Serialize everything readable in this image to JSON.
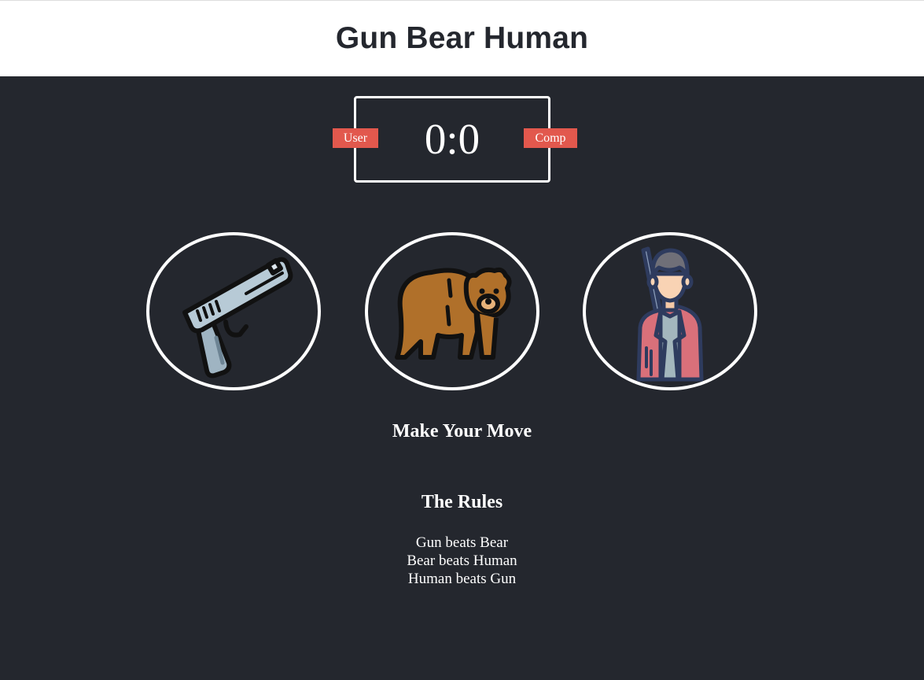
{
  "header": {
    "title": "Gun Bear Human"
  },
  "scoreboard": {
    "user_label": "User",
    "comp_label": "Comp",
    "score_text": "0:0"
  },
  "choices": [
    {
      "id": "gun",
      "icon": "gun-icon"
    },
    {
      "id": "bear",
      "icon": "bear-icon"
    },
    {
      "id": "human",
      "icon": "human-icon"
    }
  ],
  "message": "Make Your Move",
  "rules": {
    "title": "The Rules",
    "items": [
      "Gun beats Bear",
      "Bear beats Human",
      "Human beats Gun"
    ]
  },
  "colors": {
    "background": "#24272e",
    "badge": "#e2584d",
    "header_bg": "#ffffff"
  }
}
